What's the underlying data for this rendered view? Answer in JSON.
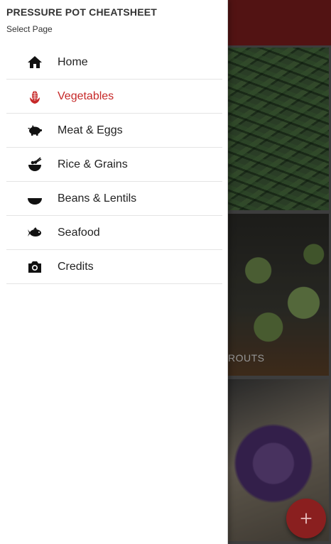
{
  "drawer": {
    "title": "PRESSURE POT CHEATSHEET",
    "subtitle": "Select Page",
    "items": [
      {
        "label": "Home",
        "icon": "home-icon",
        "active": false
      },
      {
        "label": "Vegetables",
        "icon": "corn-icon",
        "active": true
      },
      {
        "label": "Meat & Eggs",
        "icon": "pig-icon",
        "active": false
      },
      {
        "label": "Rice & Grains",
        "icon": "rice-bowl-icon",
        "active": false
      },
      {
        "label": "Beans & Lentils",
        "icon": "bowl-icon",
        "active": false
      },
      {
        "label": "Seafood",
        "icon": "fish-icon",
        "active": false
      },
      {
        "label": "Credits",
        "icon": "camera-icon",
        "active": false
      }
    ]
  },
  "background": {
    "visible_card_label": "ROUTS"
  },
  "colors": {
    "appbar": "#7a1c1c",
    "accent": "#c62828",
    "fab": "#8a1f1f"
  }
}
